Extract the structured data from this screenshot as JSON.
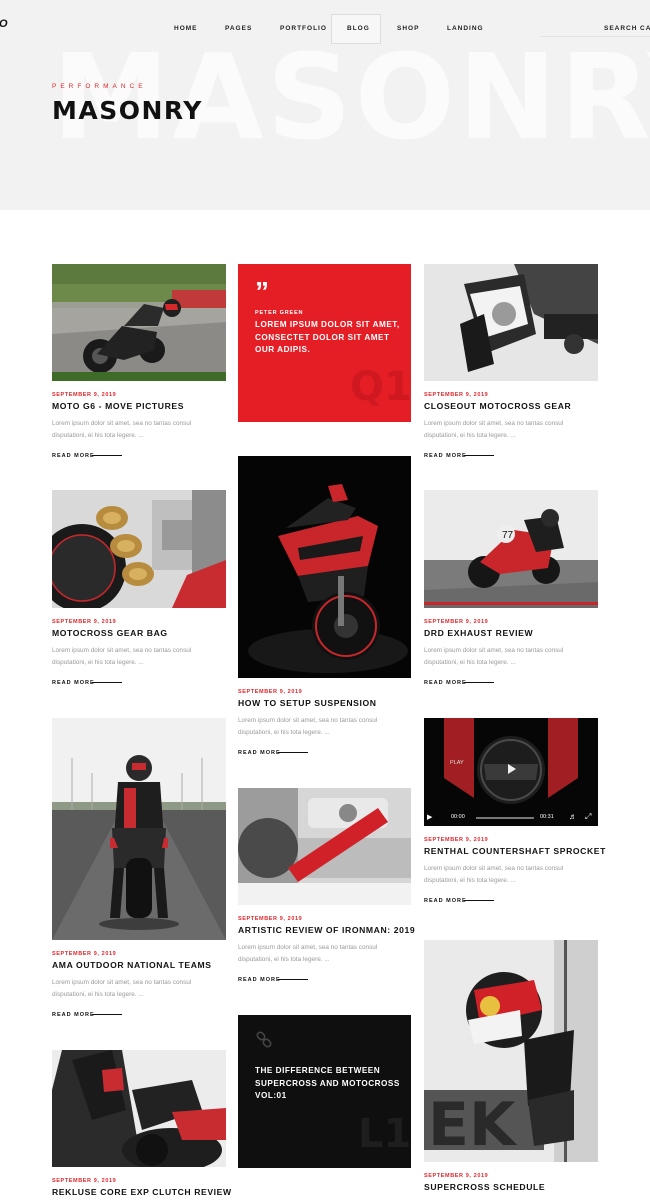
{
  "header": {
    "logo": "IO",
    "nav": [
      "HOME",
      "PAGES",
      "PORTFOLIO",
      "BLOG",
      "SHOP",
      "LANDING"
    ],
    "search_label": "SEARCH",
    "cart_label": "CA"
  },
  "hero": {
    "subtitle": "PERFORMANCE",
    "title": "MASONRY",
    "background_word": "MASONRY"
  },
  "posts": [
    {
      "date": "SEPTEMBER 9, 2019",
      "title": "MOTO G6 - MOVE PICTURES",
      "excerpt": "Lorem ipsum dolor sit amet, sea no tantas consul disputationi, ei his tota legere. ...",
      "more": "READ MORE"
    },
    {
      "date": "SEPTEMBER 9, 2019",
      "title": "CLOSEOUT MOTOCROSS GEAR",
      "excerpt": "Lorem ipsum dolor sit amet, sea no tantas consul disputationi, ei his tota legere. ...",
      "more": "READ MORE"
    },
    {
      "date": "SEPTEMBER 9, 2019",
      "title": "MOTOCROSS GEAR BAG",
      "excerpt": "Lorem ipsum dolor sit amet, sea no tantas consul disputationi, ei his tota legere. ...",
      "more": "READ MORE"
    },
    {
      "date": "SEPTEMBER 9, 2019",
      "title": "HOW TO SETUP SUSPENSION",
      "excerpt": "Lorem ipsum dolor sit amet, sea no tantas consul disputationi, ei his tota legere. ...",
      "more": "READ MORE"
    },
    {
      "date": "SEPTEMBER 9, 2019",
      "title": "DRD EXHAUST REVIEW",
      "excerpt": "Lorem ipsum dolor sit amet, sea no tantas consul disputationi, ei his tota legere. ...",
      "more": "READ MORE"
    },
    {
      "date": "SEPTEMBER 9, 2019",
      "title": "RENTHAL COUNTERSHAFT SPROCKET",
      "excerpt": "Lorem ipsum dolor sit amet, sea no tantas consul disputationi, ei his tota legere. ...",
      "more": "READ MORE"
    },
    {
      "date": "SEPTEMBER 9, 2019",
      "title": "AMA OUTDOOR NATIONAL TEAMS",
      "excerpt": "Lorem ipsum dolor sit amet, sea no tantas consul disputationi, ei his tota legere. ...",
      "more": "READ MORE"
    },
    {
      "date": "SEPTEMBER 9, 2019",
      "title": "ARTISTIC REVIEW OF IRONMAN: 2019",
      "excerpt": "Lorem ipsum dolor sit amet, sea no tantas consul disputationi, ei his tota legere. ...",
      "more": "READ MORE"
    },
    {
      "date": "SEPTEMBER 9, 2019",
      "title": "REKLUSE CORE EXP CLUTCH REVIEW"
    },
    {
      "date": "SEPTEMBER 9, 2019",
      "title": "SUPERCROSS SCHEDULE"
    }
  ],
  "quote_card": {
    "author": "PETER GREEN",
    "text": "LOREM IPSUM DOLOR SIT AMET, CONSECTET DOLOR SIT AMET OUR ADIPIS.",
    "badge": "Q1",
    "icon": "quote-icon"
  },
  "link_card": {
    "text": "THE DIFFERENCE BETWEEN SUPERCROSS AND MOTOCROSS VOL:01",
    "badge": "L1",
    "icon": "link-icon"
  },
  "video": {
    "current_time": "00:00",
    "duration": "00:31",
    "overlay": "PLAY"
  },
  "colors": {
    "accent": "#e3262b",
    "dark": "#0f0f0f",
    "hero_bg": "#f2f2f2"
  }
}
